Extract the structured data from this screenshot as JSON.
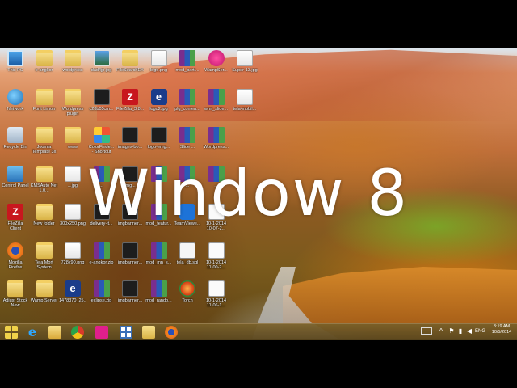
{
  "overlay": {
    "title": "Window 8"
  },
  "desktop": {
    "columns": [
      [
        {
          "label": "This PC",
          "icon": "computer-icon",
          "kind": "pc"
        },
        {
          "label": "Network",
          "icon": "network-icon",
          "kind": "net"
        },
        {
          "label": "Recycle Bin",
          "icon": "recycle-bin-icon",
          "kind": "bin"
        },
        {
          "label": "Control Panel",
          "icon": "control-panel-icon",
          "kind": "cp"
        },
        {
          "label": "FileZilla Client",
          "icon": "filezilla-icon",
          "kind": "fz"
        },
        {
          "label": "Mozilla Firefox",
          "icon": "firefox-icon",
          "kind": "ff"
        },
        {
          "label": "Adjust Stock New",
          "icon": "folder-icon",
          "kind": "folder"
        }
      ],
      [
        {
          "label": "e-angkor",
          "icon": "folder-icon",
          "kind": "folder"
        },
        {
          "label": "Font Limon",
          "icon": "folder-icon",
          "kind": "folder"
        },
        {
          "label": "Joomla Template 3x",
          "icon": "folder-icon",
          "kind": "folder"
        },
        {
          "label": "KMSAuto Net 1.0...",
          "icon": "folder-icon",
          "kind": "folder"
        },
        {
          "label": "New folder",
          "icon": "folder-icon",
          "kind": "folder"
        },
        {
          "label": "Tela Mort System",
          "icon": "folder-icon",
          "kind": "folder"
        },
        {
          "label": "Wamp Server",
          "icon": "folder-icon",
          "kind": "folder"
        }
      ],
      [
        {
          "label": "wordpress",
          "icon": "folder-icon",
          "kind": "folder"
        },
        {
          "label": "Wordpress plugin",
          "icon": "folder-icon",
          "kind": "folder"
        },
        {
          "label": "www",
          "icon": "folder-icon",
          "kind": "folder"
        },
        {
          "label": "...jpg",
          "icon": "image-file-icon",
          "kind": "img"
        },
        {
          "label": "300x250.png",
          "icon": "image-file-icon",
          "kind": "img"
        },
        {
          "label": "728x90.png",
          "icon": "image-file-icon",
          "kind": "img"
        },
        {
          "label": "1478370_25...",
          "icon": "e-app-icon",
          "kind": "e"
        }
      ],
      [
        {
          "label": "dad4jp.jpg",
          "icon": "image-file-icon",
          "kind": "imgc"
        },
        {
          "label": "c28b05cm...",
          "icon": "image-file-icon",
          "kind": "dark"
        },
        {
          "label": "ColorFinde... - Shortcut",
          "icon": "color-finder-icon",
          "kind": "grid"
        },
        {
          "label": "...",
          "icon": "archive-icon",
          "kind": "rar"
        },
        {
          "label": "delivery-it...",
          "icon": "image-file-icon",
          "kind": "dark"
        },
        {
          "label": "e-angkor.zip",
          "icon": "archive-icon",
          "kind": "rar"
        },
        {
          "label": "eclipse.zip",
          "icon": "archive-icon",
          "kind": "rar"
        }
      ],
      [
        {
          "label": "FileSearchEX",
          "icon": "folder-icon",
          "kind": "folder"
        },
        {
          "label": "FileZilla_3.8...",
          "icon": "filezilla-icon",
          "kind": "fz"
        },
        {
          "label": "images-bo...",
          "icon": "image-file-icon",
          "kind": "dark"
        },
        {
          "label": "img...",
          "icon": "image-file-icon",
          "kind": "dark"
        },
        {
          "label": "imgbanner...",
          "icon": "image-file-icon",
          "kind": "dark"
        },
        {
          "label": "imgbanner...",
          "icon": "image-file-icon",
          "kind": "dark"
        },
        {
          "label": "imgbanner...",
          "icon": "image-file-icon",
          "kind": "dark"
        }
      ],
      [
        {
          "label": "logo.png",
          "icon": "image-file-icon",
          "kind": "img"
        },
        {
          "label": "logo2.jpg",
          "icon": "e-app-icon",
          "kind": "e"
        },
        {
          "label": "logo-emg...",
          "icon": "image-file-icon",
          "kind": "dark"
        },
        {
          "label": "...",
          "icon": "archive-icon",
          "kind": "rar"
        },
        {
          "label": "mod_featur...",
          "icon": "archive-icon",
          "kind": "rar"
        },
        {
          "label": "mod_mn_s...",
          "icon": "archive-icon",
          "kind": "rar"
        },
        {
          "label": "mod_rando...",
          "icon": "archive-icon",
          "kind": "rar"
        }
      ],
      [
        {
          "label": "mod_parti...",
          "icon": "archive-icon",
          "kind": "rar"
        },
        {
          "label": "plg_conten...",
          "icon": "archive-icon",
          "kind": "rar"
        },
        {
          "label": "Slide ...",
          "icon": "archive-icon",
          "kind": "rar"
        },
        {
          "label": "...",
          "icon": "archive-icon",
          "kind": "rar"
        },
        {
          "label": "TeamViewe...",
          "icon": "teamviewer-icon",
          "kind": "team"
        },
        {
          "label": "tela_db.sql",
          "icon": "sql-file-icon",
          "kind": "sql"
        },
        {
          "label": "Torch",
          "icon": "torch-browser-icon",
          "kind": "torch"
        }
      ],
      [
        {
          "label": "WampSer...",
          "icon": "wamp-icon",
          "kind": "wamp"
        },
        {
          "label": "wmt_slide...",
          "icon": "archive-icon",
          "kind": "rar"
        },
        {
          "label": "Wordpress...",
          "icon": "archive-icon",
          "kind": "rar"
        },
        {
          "label": "...",
          "icon": "archive-icon",
          "kind": "rar"
        },
        {
          "label": "10-1-2014 10-07-2...",
          "icon": "image-file-icon",
          "kind": "file"
        },
        {
          "label": "10-1-2014 11-00-2...",
          "icon": "image-file-icon",
          "kind": "file"
        },
        {
          "label": "10-1-2014 11-06-1...",
          "icon": "image-file-icon",
          "kind": "file"
        }
      ],
      [
        {
          "label": "Super-13.jpg",
          "icon": "image-file-icon",
          "kind": "img"
        },
        {
          "label": "tela-mobil...",
          "icon": "image-file-icon",
          "kind": "img"
        }
      ]
    ]
  },
  "taskbar": {
    "pinned": [
      {
        "name": "start-button",
        "icon": "windows-logo-icon"
      },
      {
        "name": "internet-explorer",
        "icon": "internet-explorer-icon"
      },
      {
        "name": "file-explorer",
        "icon": "folder-icon"
      },
      {
        "name": "google-chrome",
        "icon": "chrome-icon"
      },
      {
        "name": "app-pink",
        "icon": "app-icon"
      },
      {
        "name": "windows-store",
        "icon": "store-icon"
      },
      {
        "name": "file-explorer-2",
        "icon": "explorer-icon"
      },
      {
        "name": "firefox",
        "icon": "firefox-icon"
      }
    ],
    "tray": {
      "language": "ENG",
      "time": "3:19 AM",
      "date": "10/5/2014"
    }
  },
  "colors": {
    "taskbar": "#6e5a28",
    "folder": "#e8c45a",
    "filezilla": "#c8171e"
  }
}
